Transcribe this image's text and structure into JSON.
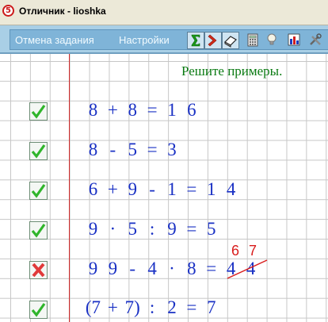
{
  "window": {
    "title": "Отличник - lioshka",
    "app_icon_glyph": "5"
  },
  "toolbar": {
    "cancel_task_label": "Отмена задания",
    "settings_label": "Настройки",
    "buttons": [
      {
        "icon": "sum-icon",
        "pressed": true
      },
      {
        "icon": "chevron-right-icon",
        "pressed": true
      },
      {
        "icon": "eraser-icon",
        "pressed": true
      },
      {
        "icon": "calculator-icon",
        "pressed": false
      },
      {
        "icon": "lightbulb-icon",
        "pressed": false
      },
      {
        "icon": "chart-icon",
        "pressed": false
      },
      {
        "icon": "tools-icon",
        "pressed": false
      }
    ]
  },
  "task": {
    "instruction": "Решите примеры.",
    "problems": [
      {
        "expression": "8+8=",
        "answer": "16",
        "result": "correct"
      },
      {
        "expression": "8-5=",
        "answer": "3",
        "result": "correct"
      },
      {
        "expression": "6+9-1=",
        "answer": "14",
        "result": "correct"
      },
      {
        "expression": "9·5:9=",
        "answer": "5",
        "result": "correct"
      },
      {
        "expression": "99-4·8=",
        "answer": "44",
        "result": "wrong",
        "correction": "67"
      },
      {
        "expression": "(7+7):2=",
        "answer": "7",
        "result": "correct"
      }
    ]
  },
  "colors": {
    "expression": "#1930c4",
    "instruction": "#0a7a12",
    "correction": "#d81c1c",
    "correct_mark": "#2fb52b",
    "wrong_mark": "#e03a3a",
    "margin_line": "#d02a2a",
    "toolbar": "#7fb4d8"
  }
}
